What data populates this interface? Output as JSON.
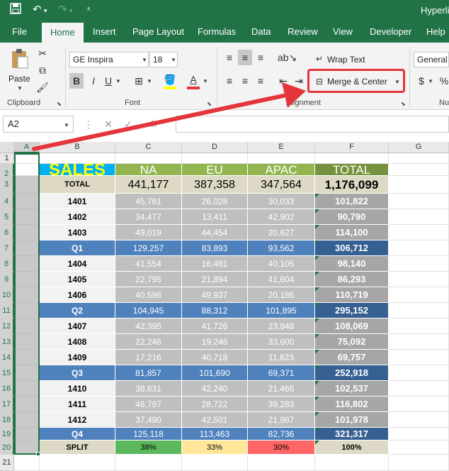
{
  "quick_access": {
    "save_icon": "floppy-disk-icon",
    "undo_icon": "undo-icon",
    "redo_icon": "redo-icon",
    "customize_icon": "chevron-down-icon"
  },
  "window": {
    "title": "Hyperli"
  },
  "tabs": [
    "File",
    "Home",
    "Insert",
    "Page Layout",
    "Formulas",
    "Data",
    "Review",
    "View",
    "Developer",
    "Help"
  ],
  "ribbon": {
    "clipboard": {
      "paste_label": "Paste",
      "group_label": "Clipboard"
    },
    "font": {
      "name": "GE Inspira",
      "size": "18",
      "group_label": "Font",
      "bold": "B",
      "italic": "I",
      "underline": "U",
      "font_color_letter": "A",
      "highlight_letter": "A"
    },
    "alignment": {
      "wrap_text": "Wrap Text",
      "merge_center": "Merge & Center",
      "group_label": "Alignment"
    },
    "number": {
      "format": "General",
      "currency": "$",
      "percent": "%",
      "group_label": "Nu"
    }
  },
  "formula_bar": {
    "name_box": "A2",
    "formula": ""
  },
  "sheet": {
    "columns": [
      "A",
      "B",
      "C",
      "D",
      "E",
      "F",
      "G"
    ],
    "rows": [
      "1",
      "2",
      "3",
      "4",
      "5",
      "6",
      "7",
      "8",
      "9",
      "10",
      "11",
      "12",
      "13",
      "14",
      "15",
      "16",
      "17",
      "18",
      "19",
      "20",
      "21"
    ],
    "table": [
      [
        "SALES",
        "NA",
        "EU",
        "APAC",
        "TOTAL"
      ],
      [
        "TOTAL",
        "441,177",
        "387,358",
        "347,564",
        "1,176,099"
      ],
      [
        "1401",
        "45,761",
        "26,028",
        "30,033",
        "101,822"
      ],
      [
        "1402",
        "34,477",
        "13,411",
        "42,902",
        "90,790"
      ],
      [
        "1403",
        "49,019",
        "44,454",
        "20,627",
        "114,100"
      ],
      [
        "Q1",
        "129,257",
        "83,893",
        "93,562",
        "306,712"
      ],
      [
        "1404",
        "41,554",
        "16,481",
        "40,105",
        "98,140"
      ],
      [
        "1405",
        "22,795",
        "21,894",
        "41,604",
        "86,293"
      ],
      [
        "1406",
        "40,596",
        "49,937",
        "20,186",
        "110,719"
      ],
      [
        "Q2",
        "104,945",
        "88,312",
        "101,895",
        "295,152"
      ],
      [
        "1407",
        "42,395",
        "41,726",
        "23,948",
        "108,069"
      ],
      [
        "1408",
        "22,246",
        "19,246",
        "33,600",
        "75,092"
      ],
      [
        "1409",
        "17,216",
        "40,718",
        "11,823",
        "69,757"
      ],
      [
        "Q3",
        "81,857",
        "101,690",
        "69,371",
        "252,918"
      ],
      [
        "1410",
        "38,831",
        "42,240",
        "21,466",
        "102,537"
      ],
      [
        "1411",
        "48,797",
        "28,722",
        "39,283",
        "116,802"
      ],
      [
        "1412",
        "37,490",
        "42,501",
        "21,987",
        "101,978"
      ],
      [
        "Q4",
        "125,118",
        "113,463",
        "82,736",
        "321,317"
      ],
      [
        "SPLIT",
        "38%",
        "33%",
        "30%",
        "100%"
      ]
    ]
  },
  "colors": {
    "excel_green": "#217346",
    "sales_header_bg": "#00b0f0",
    "sales_header_text": "#ffff00",
    "region_header_bg": "#92b550",
    "total_header_bg": "#76923c",
    "quarter_bg": "#4f81bd",
    "quarter_total_bg": "#366092",
    "month_values_bg": "#bfbfbf",
    "month_total_bg": "#a6a6a6",
    "total_row_bg": "#ddd9c4",
    "split_na": "#5cb85c",
    "split_eu": "#ffe699",
    "split_apac": "#ff6666",
    "callout_red": "#e3353a"
  }
}
